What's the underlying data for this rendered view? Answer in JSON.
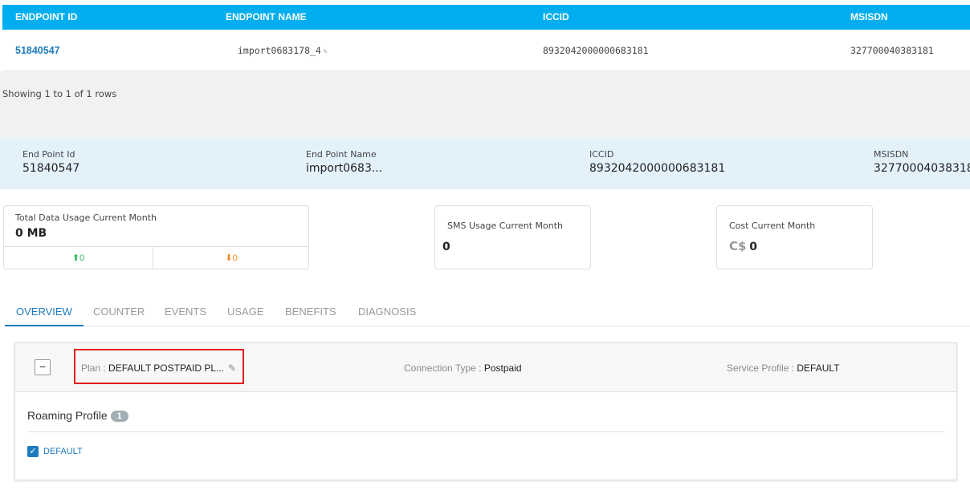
{
  "grid": {
    "headers": [
      "ENDPOINT ID",
      "ENDPOINT NAME",
      "ICCID",
      "MSISDN"
    ],
    "row": {
      "endpoint_id": "51840547",
      "endpoint_name": "import0683178_4",
      "iccid": "8932042000000683181",
      "msisdn": "327700040383181"
    },
    "pagination": "Showing 1 to 1 of 1 rows"
  },
  "summary": {
    "endpoint_id_label": "End Point Id",
    "endpoint_id": "51840547",
    "endpoint_name_label": "End Point Name",
    "endpoint_name": "import0683...",
    "iccid_label": "ICCID",
    "iccid": "8932042000000683181",
    "msisdn_label": "MSISDN",
    "msisdn": "32770004038318"
  },
  "cards": {
    "data_usage": {
      "label": "Total Data Usage Current Month",
      "value": "0 MB",
      "upload": "0",
      "download": "0"
    },
    "sms_usage": {
      "label": "SMS Usage Current Month",
      "value": "0"
    },
    "cost": {
      "label": "Cost Current Month",
      "currency": "C$",
      "value": "0"
    }
  },
  "tabs": [
    "OVERVIEW",
    "COUNTER",
    "EVENTS",
    "USAGE",
    "BENEFITS",
    "DIAGNOSIS"
  ],
  "overview": {
    "collapse_symbol": "−",
    "plan_label": "Plan : ",
    "plan_value": "DEFAULT POSTPAID PL...",
    "connection_label": "Connection Type : ",
    "connection_value": "Postpaid",
    "service_label": "Service Profile : ",
    "service_value": "DEFAULT",
    "roaming_title": "Roaming Profile",
    "roaming_count": "1",
    "roaming_item": "DEFAULT"
  },
  "colors": {
    "header_bg": "#00aeef",
    "link": "#1e7bbd",
    "upload_arrow": "#2eb85c",
    "download_arrow": "#f08c28",
    "highlight": "#e01e1e"
  },
  "icons": [
    "pencil-icon",
    "upload-arrow-icon",
    "download-arrow-icon",
    "checkbox-checked-icon",
    "collapse-minus-icon"
  ]
}
